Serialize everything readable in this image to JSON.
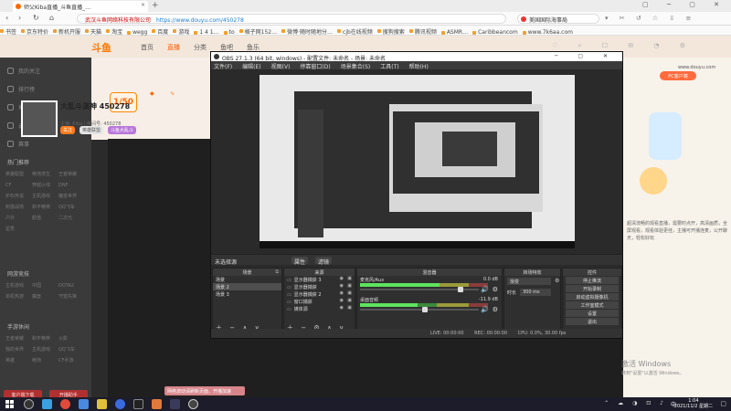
{
  "browser": {
    "tab_title": "师父Kiba直播_斗鱼直播_…",
    "tab_close": "×",
    "new_tab": "+",
    "window_controls": "▢ ─ ▢ ✕",
    "nav": {
      "back": "‹",
      "forward": "›",
      "reload": "↻",
      "home": "⌂"
    },
    "address": {
      "site_label": "武汉斗鱼网络科技有限公司",
      "url": "https://www.douyu.com/450278"
    },
    "search_text": "美国国际海事局",
    "extensions": "▾ ✂ ↺ ☆ ⇩ ≡",
    "bookmarks": [
      "书签",
      "京东特价",
      "新机开服",
      "天猫",
      "淘宝",
      "wegg",
      "百度",
      "游戏",
      "1 4 1…",
      "to",
      "格子网152…",
      "微博·随时随地分…",
      "cjb在线视频",
      "搜狗搜索",
      "腾讯视频",
      "ASMR…",
      "Caribbeancom",
      "www.7k6aa.com"
    ]
  },
  "douyu": {
    "logo": "斗鱼",
    "nav_links": [
      "首页",
      "直播",
      "分类",
      "鱼吧",
      "鱼乐"
    ],
    "nav_active_index": 1,
    "nav_right_icons": "♡ ⌕ ☐ ✉ ◔ ⚙",
    "sidebar": {
      "items": [
        "我的关注",
        "排行榜",
        "鱼吧中心",
        "云游戏",
        "赛事"
      ],
      "section1": "热门推荐",
      "grid1": [
        "英雄联盟",
        "绝地求生",
        "王者荣耀",
        "CF",
        "穿越火线",
        "DNF",
        "炉石传说",
        "主机游戏",
        "魔兽世界",
        "刺激战场",
        "和平精英",
        "QQ飞车",
        "户外",
        "颜值",
        "二次元",
        "星秀"
      ],
      "section2": "网游竞技",
      "grid2": [
        "主机游戏",
        "中国",
        "DOTA2",
        "单机热游",
        "魔兽",
        "守望先锋"
      ],
      "section3": "手游休闲",
      "grid3": [
        "王者荣耀",
        "和平精英",
        "火影",
        "我的世界",
        "主机游戏",
        "QQ飞车",
        "英雄",
        "绝地",
        "CF手游"
      ],
      "buttons": [
        "客户端下载",
        "开播助手"
      ]
    },
    "room": {
      "level": "1/50",
      "title": "大乱斗演神 450278",
      "subtitle": "主播: Kiba  |  房间号: 450278",
      "tags": [
        "关注",
        "英雄联盟",
        "斗鱼大乱斗"
      ]
    },
    "right_panel": {
      "url_fragment": "www.douyu.com",
      "badge": "PC客户端",
      "text": "超清流畅的观看直播，需要时点开，高清画质，全屏观看，观看体验更佳，主播可开播连麦，公开聊天，轻松好玩"
    },
    "notice": "网络波动请刷新页面，开播加速",
    "watermark": {
      "line1": "激活 Windows",
      "line2": "转到\"设置\"以激活 Windows。"
    }
  },
  "obs": {
    "title": "OBS 27.1.3 (64 bit, windows) - 配置文件: 未命名 - 场景: 未命名",
    "window_controls": "─ ▢ ✕",
    "menu": [
      "文件(F)",
      "编辑(E)",
      "视图(V)",
      "停靠窗口(D)",
      "场景集合(S)",
      "工具(T)",
      "帮助(H)"
    ],
    "mode_label": "未选择源",
    "mode_buttons": [
      "属性",
      "滤镜"
    ],
    "docks": {
      "scenes": {
        "title": "场景",
        "items": [
          "场景",
          "场景 2",
          "场景 3"
        ],
        "selected_index": 1
      },
      "sources": {
        "title": "来源",
        "items": [
          "显示器捕获 3",
          "显示器捕获",
          "显示器捕获 2",
          "窗口捕获",
          "媒体源"
        ]
      },
      "mixer": {
        "title": "混音器",
        "channels": [
          {
            "name": "麦克风/Aux",
            "db": "0.0 dB",
            "level": 0.62,
            "fader": 0.86
          },
          {
            "name": "桌面音频",
            "db": "-11.9 dB",
            "level": 0.45,
            "fader": 0.55
          }
        ]
      },
      "transitions": {
        "title": "转场特效",
        "select": "渐变",
        "duration_label": "时长",
        "duration_value": "300 ms"
      },
      "controls": {
        "title": "控件",
        "buttons": [
          "停止推流",
          "开始录制",
          "启动虚拟摄像机",
          "工作室模式",
          "设置",
          "退出"
        ]
      }
    },
    "statusbar": [
      "LIVE: 00:00:00",
      "REC: 00:00:00",
      "CPU: 0.0%, 30.00 fps"
    ]
  },
  "taskbar": {
    "tray": "⌃ ☁ ◑ ⊡ ♪",
    "lang": "中",
    "time": "1:04",
    "date": "2021/11/2 星期二",
    "notif": "▢"
  },
  "colors": {
    "accent": "#ff7700",
    "obs_bg": "#2a2a2a",
    "browser_bg": "#fafafa"
  }
}
